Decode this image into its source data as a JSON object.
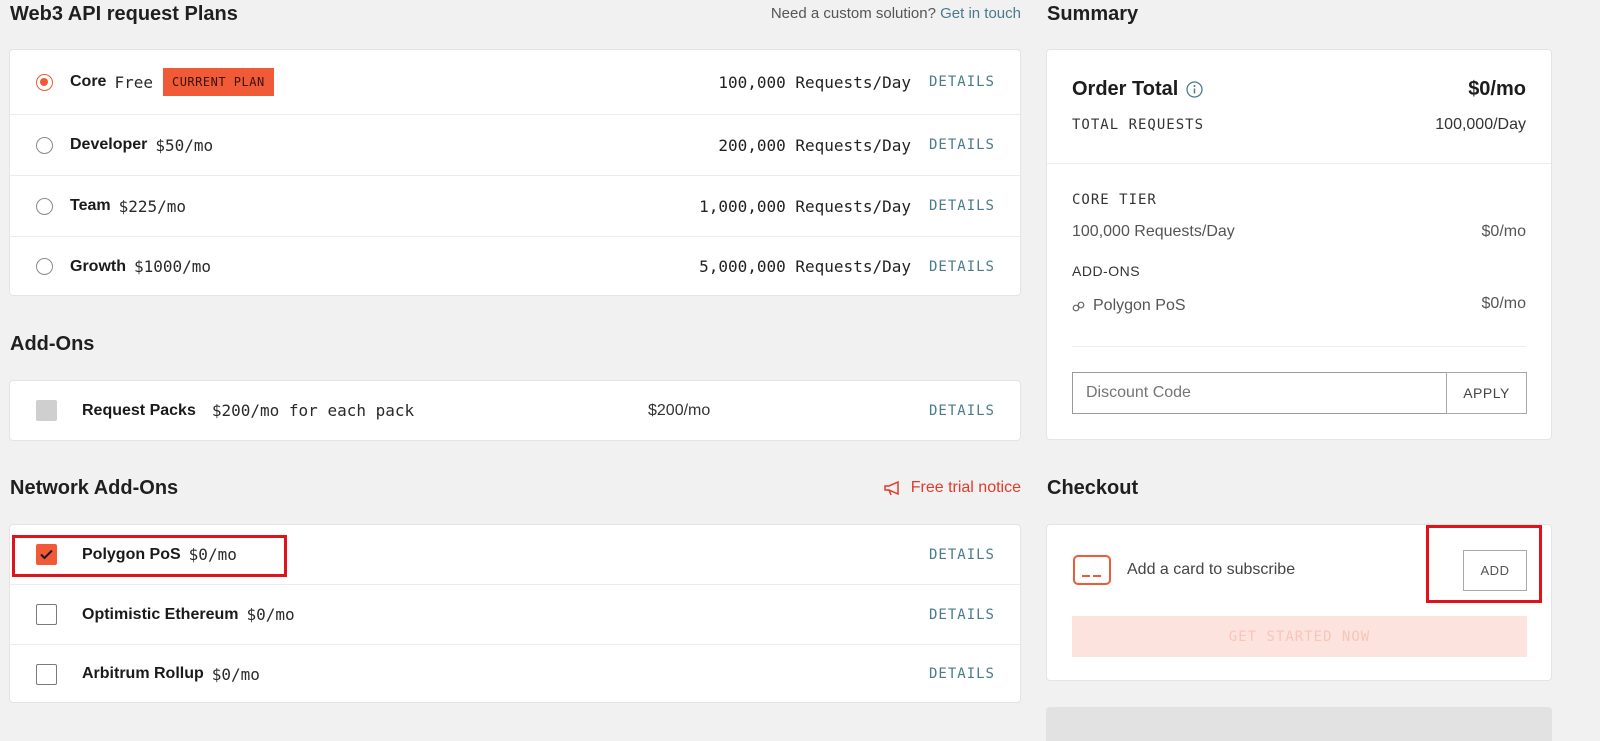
{
  "header": {
    "title": "Web3 API request Plans",
    "custom_prompt": "Need a custom solution?",
    "custom_link": "Get in touch"
  },
  "plans": [
    {
      "name": "Core",
      "price": "Free",
      "badge": "CURRENT PLAN",
      "requests": "100,000 Requests/Day",
      "details": "DETAILS",
      "selected": true
    },
    {
      "name": "Developer",
      "price": "$50/mo",
      "requests": "200,000 Requests/Day",
      "details": "DETAILS",
      "selected": false
    },
    {
      "name": "Team",
      "price": "$225/mo",
      "requests": "1,000,000 Requests/Day",
      "details": "DETAILS",
      "selected": false
    },
    {
      "name": "Growth",
      "price": "$1000/mo",
      "requests": "5,000,000 Requests/Day",
      "details": "DETAILS",
      "selected": false
    }
  ],
  "addons": {
    "title": "Add-Ons",
    "items": [
      {
        "name": "Request Packs",
        "desc": "$200/mo for each pack",
        "total": "$200/mo",
        "details": "DETAILS"
      }
    ]
  },
  "network_addons": {
    "title": "Network Add-Ons",
    "notice": "Free trial notice",
    "items": [
      {
        "name": "Polygon PoS",
        "price": "$0/mo",
        "details": "DETAILS",
        "checked": true
      },
      {
        "name": "Optimistic Ethereum",
        "price": "$0/mo",
        "details": "DETAILS",
        "checked": false
      },
      {
        "name": "Arbitrum Rollup",
        "price": "$0/mo",
        "details": "DETAILS",
        "checked": false
      }
    ]
  },
  "summary": {
    "title": "Summary",
    "order_total_label": "Order Total",
    "order_total_value": "$0/mo",
    "total_requests_label": "TOTAL REQUESTS",
    "total_requests_value": "100,000/Day",
    "tier_label": "CORE TIER",
    "tier_requests": "100,000 Requests/Day",
    "tier_price": "$0/mo",
    "addons_label": "ADD-ONS",
    "addon_name": "Polygon PoS",
    "addon_price": "$0/mo",
    "discount_placeholder": "Discount Code",
    "apply_label": "APPLY"
  },
  "checkout": {
    "title": "Checkout",
    "card_text": "Add a card to subscribe",
    "add_label": "ADD",
    "get_started_label": "GET STARTED NOW"
  },
  "colors": {
    "accent": "#f05a36",
    "link": "#4a7a8c",
    "highlight": "#e0121a"
  }
}
